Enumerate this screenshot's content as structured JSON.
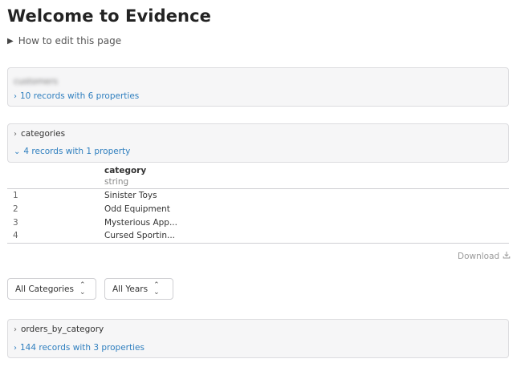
{
  "page": {
    "title": "Welcome to Evidence",
    "details_label": "How to edit this page"
  },
  "panels": {
    "customers": {
      "name": "customers",
      "records": "10 records with 6 properties"
    },
    "categories": {
      "name": "categories",
      "records": "4 records with 1 property"
    },
    "orders": {
      "name": "orders_by_category",
      "records": "144 records with 3 properties"
    }
  },
  "table": {
    "column": "category",
    "column_type": "string",
    "rows": [
      {
        "index": "1",
        "category": "Sinister Toys"
      },
      {
        "index": "2",
        "category": "Odd Equipment"
      },
      {
        "index": "3",
        "category": "Mysterious App..."
      },
      {
        "index": "4",
        "category": "Cursed Sportin..."
      }
    ]
  },
  "download": {
    "label": "Download"
  },
  "filters": {
    "categories": "All Categories",
    "years": "All Years"
  },
  "colors": {
    "link": "#2f7fbf",
    "panel_bg": "#f6f6f7",
    "border": "#dcdcdf"
  }
}
